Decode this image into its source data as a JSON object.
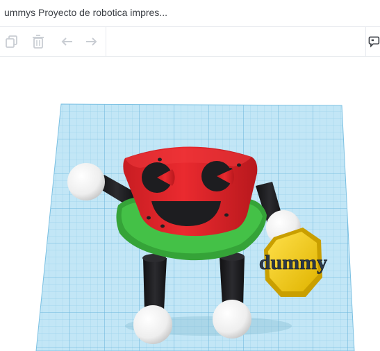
{
  "window": {
    "title": "ummys Proyecto de robotica impres..."
  },
  "toolbar": {
    "tools": [
      {
        "name": "copy",
        "icon": "copy-icon",
        "state": "disabled"
      },
      {
        "name": "delete",
        "icon": "trash-icon",
        "state": "disabled"
      },
      {
        "name": "undo",
        "icon": "undo-arrow-icon",
        "state": "disabled"
      },
      {
        "name": "redo",
        "icon": "redo-arrow-icon",
        "state": "disabled"
      },
      {
        "name": "comment",
        "icon": "speech-bubble-icon",
        "state": "enabled"
      }
    ]
  },
  "scene": {
    "sign_text": "dummy",
    "colors": {
      "workplane": "#bfe6f5",
      "grid_line": "#8ecbe6",
      "body_red": "#e0262b",
      "rind_green": "#37b33a",
      "limb_black": "#1f1f22",
      "ball_white": "#f4f4f4",
      "sign_gold": "#f2cd1c"
    }
  }
}
